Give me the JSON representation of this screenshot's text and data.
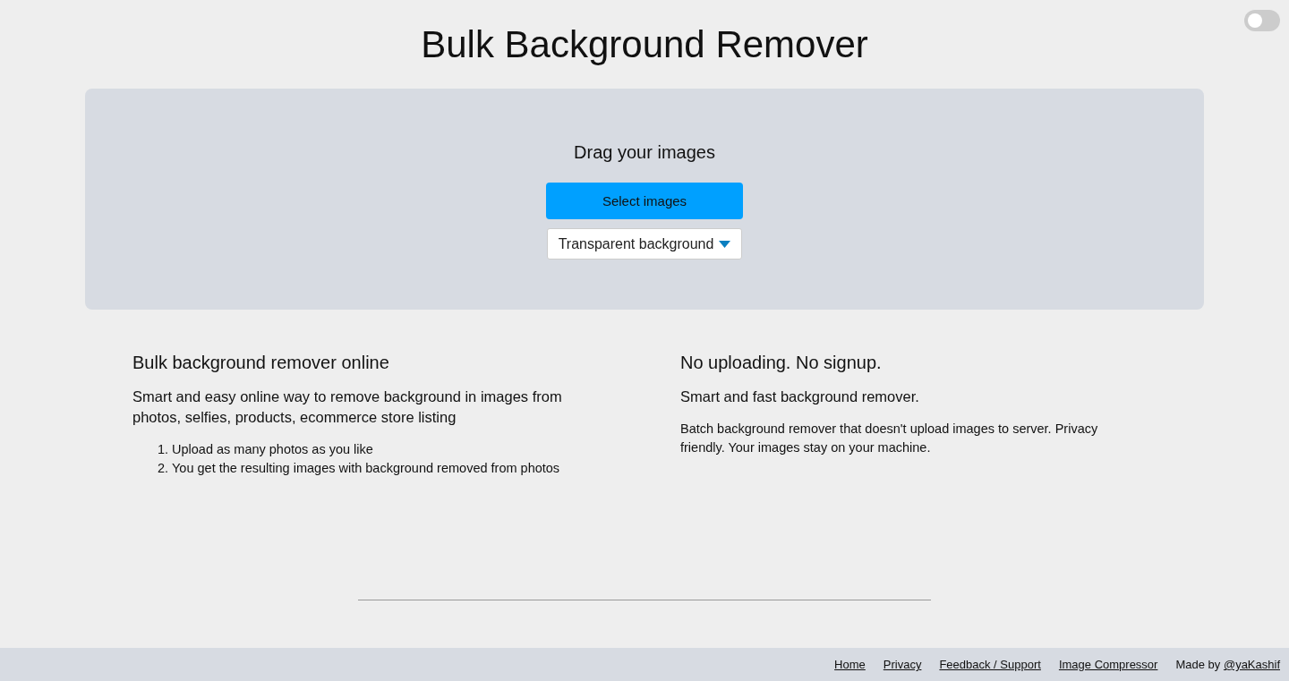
{
  "theme_toggle": {
    "on": false
  },
  "title": "Bulk Background Remover",
  "dropzone": {
    "prompt": "Drag your images",
    "button": "Select images",
    "background_select": {
      "value": "Transparent background"
    }
  },
  "features": [
    {
      "heading": "Bulk background remover online",
      "lead": "Smart and easy online way to remove background in images from photos, selfies, products, ecommerce store listing",
      "steps": [
        {
          "marker": "1.",
          "text": "Upload as many photos as you like"
        },
        {
          "marker": "2.",
          "text": "You get the resulting images with background removed from photos"
        }
      ]
    },
    {
      "heading": "No uploading. No signup.",
      "lead": "Smart and fast background remover.",
      "body": "Batch background remover that doesn't upload images to server. Privacy friendly. Your images stay on your machine."
    }
  ],
  "footer": {
    "links": [
      "Home",
      "Privacy",
      "Feedback / Support",
      "Image Compressor"
    ],
    "credit": {
      "prefix": "Made by",
      "link": "@yaKashif"
    }
  }
}
